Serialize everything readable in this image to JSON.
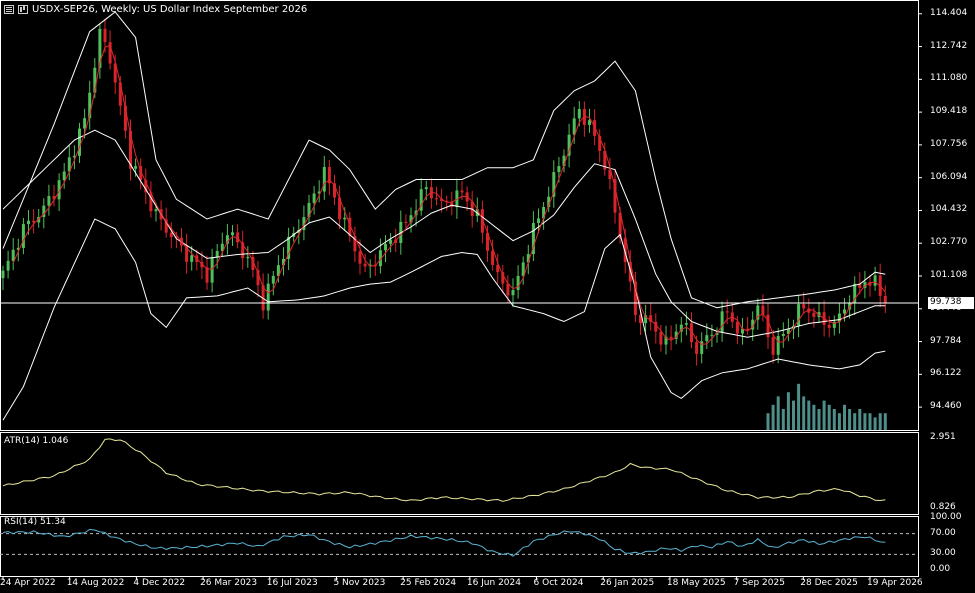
{
  "header": {
    "title": "USDX-SEP26, Weekly:  US Dollar Index September 2026"
  },
  "colors": {
    "background": "#000000",
    "bull": "#4fbf5a",
    "bear": "#d8242b",
    "band": "#ffffff",
    "ma": "#e0262e",
    "volume": "#4f8f8a",
    "atr": "#e8e89a",
    "rsi": "#5ab4d4",
    "grid": "#ffffff"
  },
  "chart_data": [
    {
      "type": "candlestick",
      "title": "USDX-SEP26, Weekly:  US Dollar Index September 2026",
      "ylim": [
        93.3,
        114.9
      ],
      "y_ticks": [
        "114.404",
        "112.742",
        "111.080",
        "109.418",
        "107.756",
        "106.094",
        "104.432",
        "102.770",
        "101.108",
        "99.446",
        "97.784",
        "96.122",
        "94.460"
      ],
      "current_price": "99.738",
      "x_labels": [
        "24 Apr 2022",
        "14 Aug 2022",
        "4 Dec 2022",
        "26 Mar 2023",
        "16 Jul 2023",
        "5 Nov 2023",
        "25 Feb 2024",
        "16 Jun 2024",
        "6 Oct 2024",
        "26 Jan 2025",
        "18 May 2025",
        "7 Sep 2025",
        "28 Dec 2025",
        "19 Apr 2026"
      ],
      "price_anchors": [
        [
          0,
          101.2
        ],
        [
          4,
          103.5
        ],
        [
          8,
          104.5
        ],
        [
          12,
          106.3
        ],
        [
          16,
          109.0
        ],
        [
          19,
          113.4
        ],
        [
          21,
          112.2
        ],
        [
          25,
          107.0
        ],
        [
          30,
          104.2
        ],
        [
          35,
          102.5
        ],
        [
          40,
          101.2
        ],
        [
          44,
          103.4
        ],
        [
          48,
          102.0
        ],
        [
          51,
          99.8
        ],
        [
          55,
          102.3
        ],
        [
          60,
          104.6
        ],
        [
          63,
          106.4
        ],
        [
          67,
          103.7
        ],
        [
          71,
          101.3
        ],
        [
          75,
          102.6
        ],
        [
          79,
          103.8
        ],
        [
          83,
          105.6
        ],
        [
          86,
          104.7
        ],
        [
          90,
          105.3
        ],
        [
          93,
          104.1
        ],
        [
          97,
          101.0
        ],
        [
          100,
          100.2
        ],
        [
          104,
          103.4
        ],
        [
          108,
          106.0
        ],
        [
          111,
          108.2
        ],
        [
          113,
          109.6
        ],
        [
          116,
          108.2
        ],
        [
          118,
          106.8
        ],
        [
          121,
          103.2
        ],
        [
          124,
          99.2
        ],
        [
          127,
          98.7
        ],
        [
          130,
          97.6
        ],
        [
          133,
          98.8
        ],
        [
          136,
          97.4
        ],
        [
          139,
          98.2
        ],
        [
          142,
          99.3
        ],
        [
          145,
          98.0
        ],
        [
          148,
          99.6
        ],
        [
          151,
          97.4
        ],
        [
          154,
          98.5
        ],
        [
          157,
          99.6
        ],
        [
          160,
          98.9
        ],
        [
          163,
          98.6
        ],
        [
          166,
          100.0
        ],
        [
          169,
          100.9
        ],
        [
          171,
          100.7
        ],
        [
          173,
          99.9
        ]
      ],
      "bands": {
        "upper": [
          [
            0,
            102.5
          ],
          [
            10,
            108.8
          ],
          [
            17,
            113.5
          ],
          [
            22,
            114.5
          ],
          [
            26,
            113.2
          ],
          [
            30,
            107.0
          ],
          [
            34,
            105.0
          ],
          [
            40,
            104.0
          ],
          [
            46,
            104.5
          ],
          [
            52,
            104.0
          ],
          [
            57,
            106.5
          ],
          [
            60,
            108.0
          ],
          [
            64,
            107.5
          ],
          [
            68,
            106.5
          ],
          [
            73,
            104.5
          ],
          [
            77,
            105.5
          ],
          [
            81,
            106.0
          ],
          [
            85,
            106.0
          ],
          [
            90,
            106.0
          ],
          [
            95,
            106.6
          ],
          [
            100,
            106.6
          ],
          [
            104,
            107.0
          ],
          [
            108,
            109.5
          ],
          [
            112,
            110.5
          ],
          [
            116,
            111.0
          ],
          [
            120,
            112.0
          ],
          [
            124,
            110.5
          ],
          [
            128,
            106.0
          ],
          [
            131,
            103.0
          ],
          [
            135,
            100.0
          ],
          [
            140,
            99.5
          ],
          [
            146,
            99.8
          ],
          [
            152,
            100.0
          ],
          [
            158,
            100.2
          ],
          [
            163,
            100.4
          ],
          [
            168,
            100.7
          ],
          [
            171,
            101.3
          ],
          [
            173,
            101.2
          ]
        ],
        "middle": [
          [
            0,
            104.5
          ],
          [
            8,
            106.5
          ],
          [
            14,
            108.0
          ],
          [
            18,
            108.5
          ],
          [
            22,
            108.0
          ],
          [
            28,
            105.5
          ],
          [
            34,
            103.0
          ],
          [
            40,
            102.0
          ],
          [
            46,
            102.2
          ],
          [
            52,
            102.3
          ],
          [
            56,
            103.0
          ],
          [
            60,
            103.8
          ],
          [
            64,
            104.1
          ],
          [
            68,
            103.2
          ],
          [
            72,
            102.3
          ],
          [
            76,
            103.0
          ],
          [
            80,
            103.6
          ],
          [
            84,
            104.3
          ],
          [
            88,
            104.7
          ],
          [
            92,
            104.5
          ],
          [
            96,
            103.7
          ],
          [
            100,
            102.9
          ],
          [
            104,
            103.4
          ],
          [
            108,
            104.2
          ],
          [
            112,
            105.6
          ],
          [
            116,
            106.8
          ],
          [
            120,
            106.5
          ],
          [
            124,
            104.0
          ],
          [
            128,
            101.2
          ],
          [
            131,
            99.8
          ],
          [
            135,
            98.8
          ],
          [
            140,
            98.3
          ],
          [
            146,
            98.0
          ],
          [
            152,
            98.3
          ],
          [
            158,
            98.7
          ],
          [
            164,
            98.9
          ],
          [
            168,
            99.3
          ],
          [
            171,
            99.6
          ],
          [
            173,
            99.6
          ]
        ],
        "lower": [
          [
            0,
            93.8
          ],
          [
            4,
            95.5
          ],
          [
            10,
            99.5
          ],
          [
            18,
            104.0
          ],
          [
            22,
            103.5
          ],
          [
            26,
            101.8
          ],
          [
            29,
            99.2
          ],
          [
            32,
            98.5
          ],
          [
            36,
            100.0
          ],
          [
            42,
            100.1
          ],
          [
            48,
            100.5
          ],
          [
            52,
            99.8
          ],
          [
            58,
            99.9
          ],
          [
            63,
            100.1
          ],
          [
            68,
            100.5
          ],
          [
            72,
            100.7
          ],
          [
            76,
            100.8
          ],
          [
            80,
            101.3
          ],
          [
            86,
            102.1
          ],
          [
            90,
            102.3
          ],
          [
            93,
            102.2
          ],
          [
            96,
            101.0
          ],
          [
            100,
            99.6
          ],
          [
            106,
            99.2
          ],
          [
            110,
            98.8
          ],
          [
            114,
            99.3
          ],
          [
            118,
            102.5
          ],
          [
            121,
            103.2
          ],
          [
            124,
            100.5
          ],
          [
            127,
            97.0
          ],
          [
            131,
            95.2
          ],
          [
            133,
            94.9
          ],
          [
            137,
            95.8
          ],
          [
            141,
            96.2
          ],
          [
            146,
            96.4
          ],
          [
            152,
            96.9
          ],
          [
            158,
            96.6
          ],
          [
            164,
            96.4
          ],
          [
            168,
            96.6
          ],
          [
            171,
            97.2
          ],
          [
            173,
            97.3
          ]
        ]
      },
      "volume_bars": [
        4,
        6,
        8,
        5,
        9,
        7,
        11,
        8,
        7,
        6,
        5,
        7,
        6,
        5,
        4,
        6,
        5,
        4,
        5,
        4,
        4,
        3,
        4,
        4
      ]
    },
    {
      "type": "line",
      "title": "ATR(14) 1.046",
      "ylim": [
        0.826,
        2.951
      ],
      "y_ticks": [
        "2.951",
        "0.826"
      ],
      "anchors": [
        [
          0,
          1.5
        ],
        [
          10,
          1.8
        ],
        [
          17,
          2.3
        ],
        [
          20,
          2.9
        ],
        [
          23,
          2.9
        ],
        [
          27,
          2.5
        ],
        [
          32,
          1.9
        ],
        [
          38,
          1.55
        ],
        [
          44,
          1.45
        ],
        [
          50,
          1.35
        ],
        [
          56,
          1.3
        ],
        [
          62,
          1.25
        ],
        [
          68,
          1.3
        ],
        [
          74,
          1.15
        ],
        [
          80,
          1.05
        ],
        [
          86,
          1.15
        ],
        [
          92,
          1.1
        ],
        [
          98,
          1.05
        ],
        [
          104,
          1.2
        ],
        [
          110,
          1.4
        ],
        [
          116,
          1.7
        ],
        [
          120,
          1.9
        ],
        [
          123,
          2.15
        ],
        [
          126,
          2.05
        ],
        [
          131,
          2.0
        ],
        [
          136,
          1.7
        ],
        [
          142,
          1.35
        ],
        [
          148,
          1.15
        ],
        [
          154,
          1.15
        ],
        [
          160,
          1.35
        ],
        [
          164,
          1.4
        ],
        [
          168,
          1.2
        ],
        [
          172,
          1.05
        ],
        [
          173,
          1.046
        ]
      ]
    },
    {
      "type": "line",
      "title": "RSI(14) 51.34",
      "ylim": [
        0,
        100
      ],
      "y_ticks": [
        "100.00",
        "70.00",
        "30.00",
        "0.00"
      ],
      "levels": [
        70,
        30
      ],
      "anchors": [
        [
          0,
          72
        ],
        [
          6,
          73
        ],
        [
          12,
          64
        ],
        [
          18,
          78
        ],
        [
          22,
          62
        ],
        [
          26,
          50
        ],
        [
          30,
          42
        ],
        [
          34,
          42
        ],
        [
          40,
          46
        ],
        [
          46,
          52
        ],
        [
          50,
          45
        ],
        [
          55,
          64
        ],
        [
          60,
          68
        ],
        [
          64,
          54
        ],
        [
          68,
          44
        ],
        [
          72,
          50
        ],
        [
          76,
          57
        ],
        [
          80,
          65
        ],
        [
          84,
          62
        ],
        [
          88,
          58
        ],
        [
          92,
          52
        ],
        [
          96,
          35
        ],
        [
          100,
          28
        ],
        [
          104,
          55
        ],
        [
          108,
          68
        ],
        [
          111,
          75
        ],
        [
          114,
          70
        ],
        [
          117,
          60
        ],
        [
          120,
          40
        ],
        [
          123,
          32
        ],
        [
          126,
          34
        ],
        [
          130,
          42
        ],
        [
          133,
          38
        ],
        [
          136,
          47
        ],
        [
          139,
          44
        ],
        [
          142,
          55
        ],
        [
          145,
          45
        ],
        [
          148,
          58
        ],
        [
          151,
          42
        ],
        [
          154,
          52
        ],
        [
          157,
          58
        ],
        [
          160,
          50
        ],
        [
          163,
          55
        ],
        [
          166,
          61
        ],
        [
          169,
          64
        ],
        [
          171,
          58
        ],
        [
          173,
          51.34
        ]
      ]
    }
  ]
}
